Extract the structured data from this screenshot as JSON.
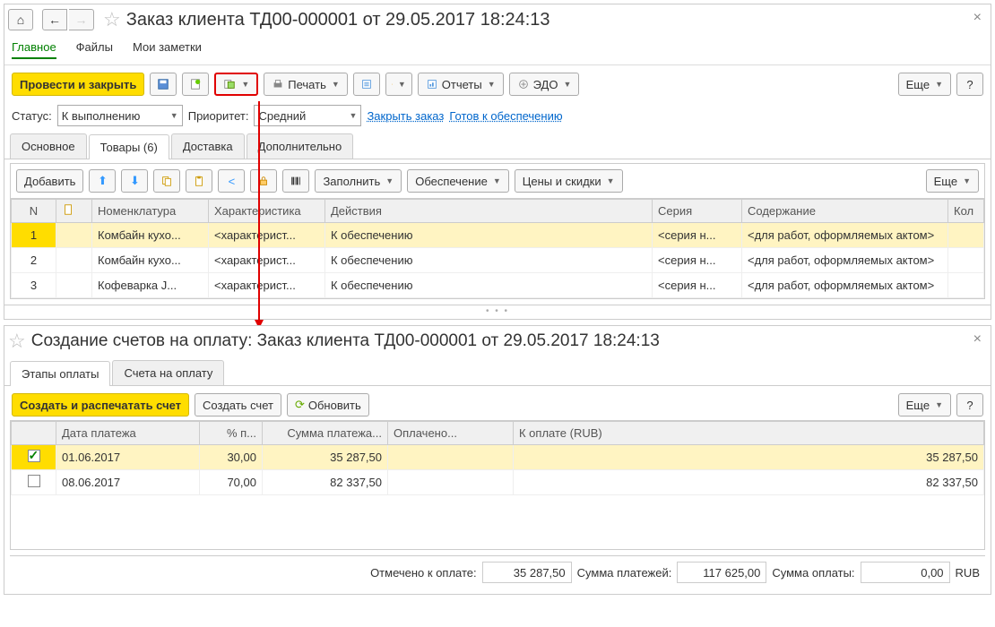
{
  "top": {
    "title": "Заказ клиента ТД00-000001 от 29.05.2017 18:24:13",
    "menu": [
      "Главное",
      "Файлы",
      "Мои заметки"
    ],
    "toolbar": {
      "main": "Провести и закрыть",
      "print": "Печать",
      "reports": "Отчеты",
      "edo": "ЭДО",
      "more": "Еще"
    },
    "form": {
      "status_label": "Статус:",
      "status_value": "К выполнению",
      "priority_label": "Приоритет:",
      "priority_value": "Средний",
      "link_close": "Закрыть заказ",
      "link_supply": "Готов к обеспечению"
    },
    "tabs": [
      "Основное",
      "Товары (6)",
      "Доставка",
      "Дополнительно"
    ],
    "inner_toolbar": {
      "add": "Добавить",
      "fill": "Заполнить",
      "supply": "Обеспечение",
      "prices": "Цены и скидки",
      "more": "Еще"
    },
    "grid": {
      "headers": [
        "N",
        "",
        "Номенклатура",
        "Характеристика",
        "Действия",
        "Серия",
        "Содержание",
        "Кол"
      ],
      "rows": [
        {
          "n": "1",
          "nom": "Комбайн кухо...",
          "char": "<характерист...",
          "act": "К обеспечению",
          "ser": "<серия н...",
          "cont": "<для работ, оформляемых актом>"
        },
        {
          "n": "2",
          "nom": "Комбайн кухо...",
          "char": "<характерист...",
          "act": "К обеспечению",
          "ser": "<серия н...",
          "cont": "<для работ, оформляемых актом>"
        },
        {
          "n": "3",
          "nom": "Кофеварка J...",
          "char": "<характерист...",
          "act": "К обеспечению",
          "ser": "<серия н...",
          "cont": "<для работ, оформляемых актом>"
        }
      ]
    }
  },
  "bottom": {
    "title": "Создание счетов на оплату: Заказ клиента ТД00-000001 от 29.05.2017 18:24:13",
    "tabs": [
      "Этапы оплаты",
      "Счета на оплату"
    ],
    "toolbar": {
      "main": "Создать и распечатать счет",
      "create": "Создать счет",
      "refresh": "Обновить",
      "more": "Еще"
    },
    "grid": {
      "headers": [
        "",
        "Дата платежа",
        "% п...",
        "Сумма платежа...",
        "Оплачено...",
        "К оплате (RUB)"
      ],
      "rows": [
        {
          "checked": true,
          "date": "01.06.2017",
          "pct": "30,00",
          "sum": "35 287,50",
          "paid": "",
          "due": "35 287,50"
        },
        {
          "checked": false,
          "date": "08.06.2017",
          "pct": "70,00",
          "sum": "82 337,50",
          "paid": "",
          "due": "82 337,50"
        }
      ]
    },
    "summary": {
      "marked_label": "Отмечено к оплате:",
      "marked_value": "35 287,50",
      "total_label": "Сумма платежей:",
      "total_value": "117 625,00",
      "pay_label": "Сумма оплаты:",
      "pay_value": "0,00",
      "currency": "RUB"
    }
  }
}
